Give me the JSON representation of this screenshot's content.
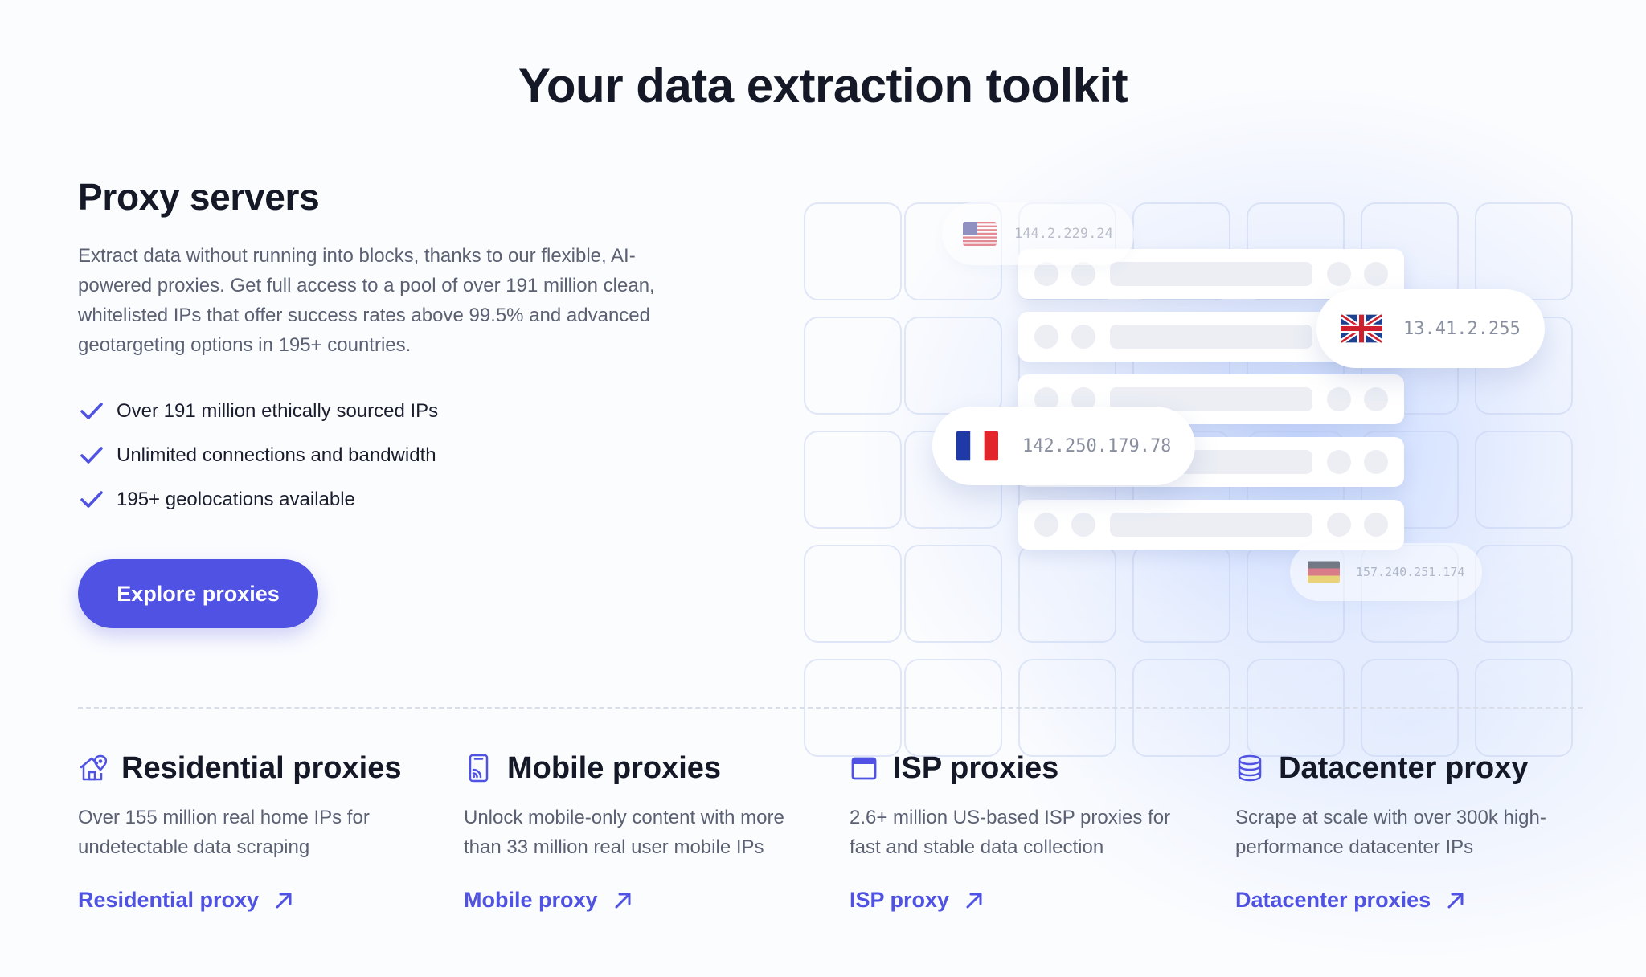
{
  "headline": "Your data extraction toolkit",
  "proxy_servers": {
    "title": "Proxy servers",
    "description": "Extract data without running into blocks, thanks to our flexible, AI-powered proxies. Get full access to a pool of over 191 million clean, whitelisted IPs that offer success rates above 99.5% and advanced geotargeting options in 195+ countries.",
    "features": [
      "Over 191 million ethically sourced IPs",
      "Unlimited connections and bandwidth",
      "195+ geolocations available"
    ],
    "cta_label": "Explore proxies"
  },
  "illustration": {
    "ips": [
      {
        "country": "us",
        "ip": "144.2.229.24"
      },
      {
        "country": "uk",
        "ip": "13.41.2.255"
      },
      {
        "country": "fr",
        "ip": "142.250.179.78"
      },
      {
        "country": "de",
        "ip": "157.240.251.174"
      }
    ]
  },
  "products": [
    {
      "icon": "home-pin-icon",
      "title": "Residential proxies",
      "description": "Over 155 million real home IPs for undetectable data scraping",
      "link": "Residential proxy"
    },
    {
      "icon": "mobile-signal-icon",
      "title": "Mobile proxies",
      "description": "Unlock mobile-only content with more than 33 million real user mobile IPs",
      "link": "Mobile proxy"
    },
    {
      "icon": "browser-window-icon",
      "title": "ISP proxies",
      "description": "2.6+ million US-based ISP proxies for fast and stable data collection",
      "link": "ISP proxy"
    },
    {
      "icon": "database-icon",
      "title": "Datacenter proxy",
      "description": "Scrape at scale with over 300k high-performance datacenter IPs",
      "link": "Datacenter proxies"
    }
  ],
  "colors": {
    "accent": "#4f52e2",
    "heading": "#141827",
    "body": "#5b6173"
  }
}
